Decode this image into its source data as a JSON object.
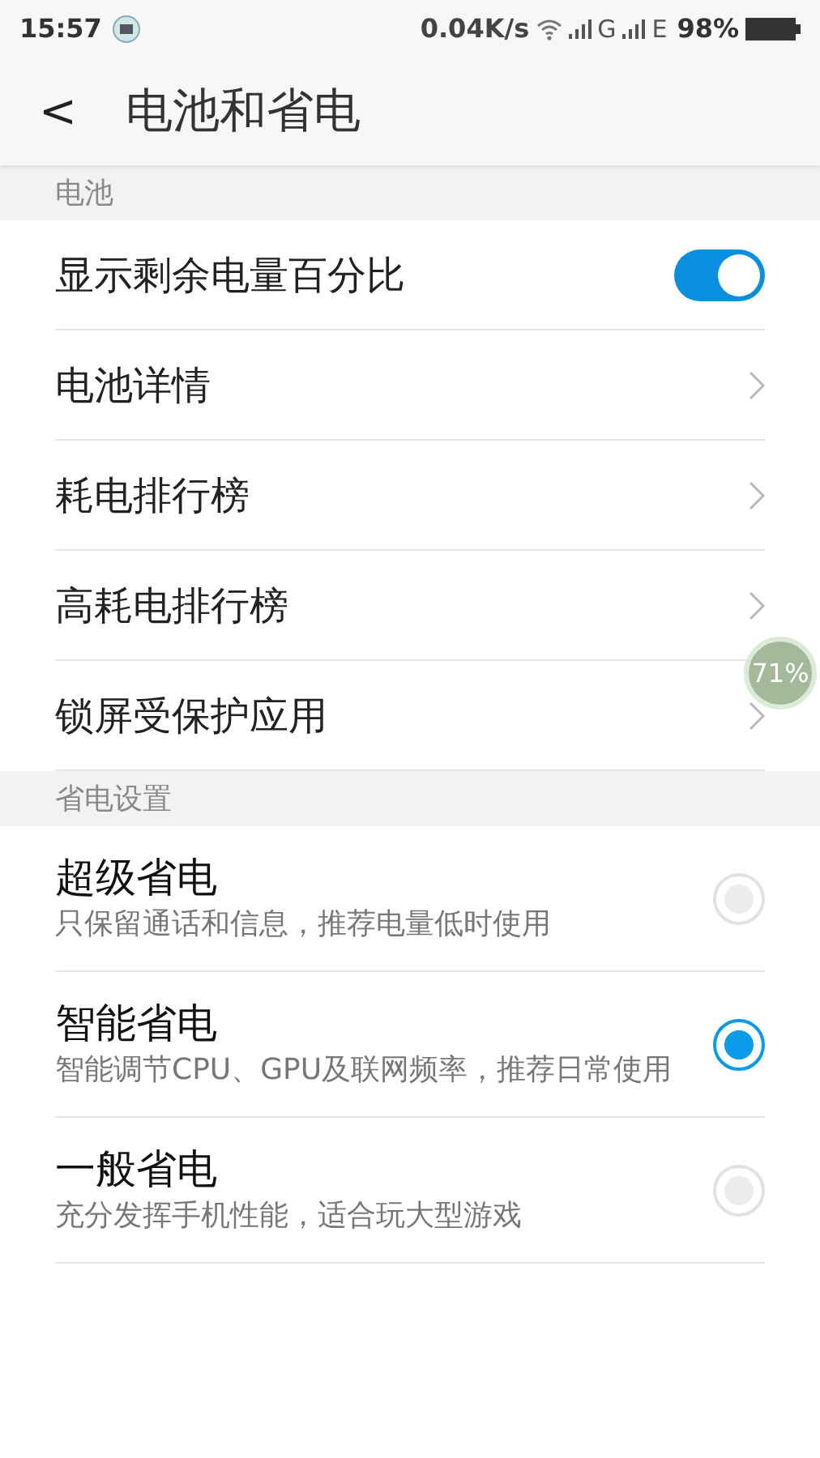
{
  "status_bar": {
    "time": "15:57",
    "speed": "0.04K/s",
    "network_1": "G",
    "network_2": "E",
    "battery": "98%"
  },
  "header": {
    "back": "<",
    "title": "电池和省电"
  },
  "sections": [
    {
      "title": "电池",
      "items": [
        {
          "kind": "toggle",
          "label": "显示剩余电量百分比",
          "on": true
        },
        {
          "kind": "link",
          "label": "电池详情"
        },
        {
          "kind": "link",
          "label": "耗电排行榜"
        },
        {
          "kind": "link",
          "label": "高耗电排行榜"
        },
        {
          "kind": "link",
          "label": "锁屏受保护应用"
        }
      ]
    },
    {
      "title": "省电设置",
      "items": [
        {
          "kind": "radio",
          "label": "超级省电",
          "description": "只保留通话和信息，推荐电量低时使用",
          "selected": false
        },
        {
          "kind": "radio",
          "label": "智能省电",
          "description": "智能调节CPU、GPU及联网频率，推荐日常使用",
          "selected": true
        },
        {
          "kind": "radio",
          "label": "一般省电",
          "description": "充分发挥手机性能，适合玩大型游戏",
          "selected": false
        }
      ]
    }
  ],
  "floating_badge": "71%"
}
